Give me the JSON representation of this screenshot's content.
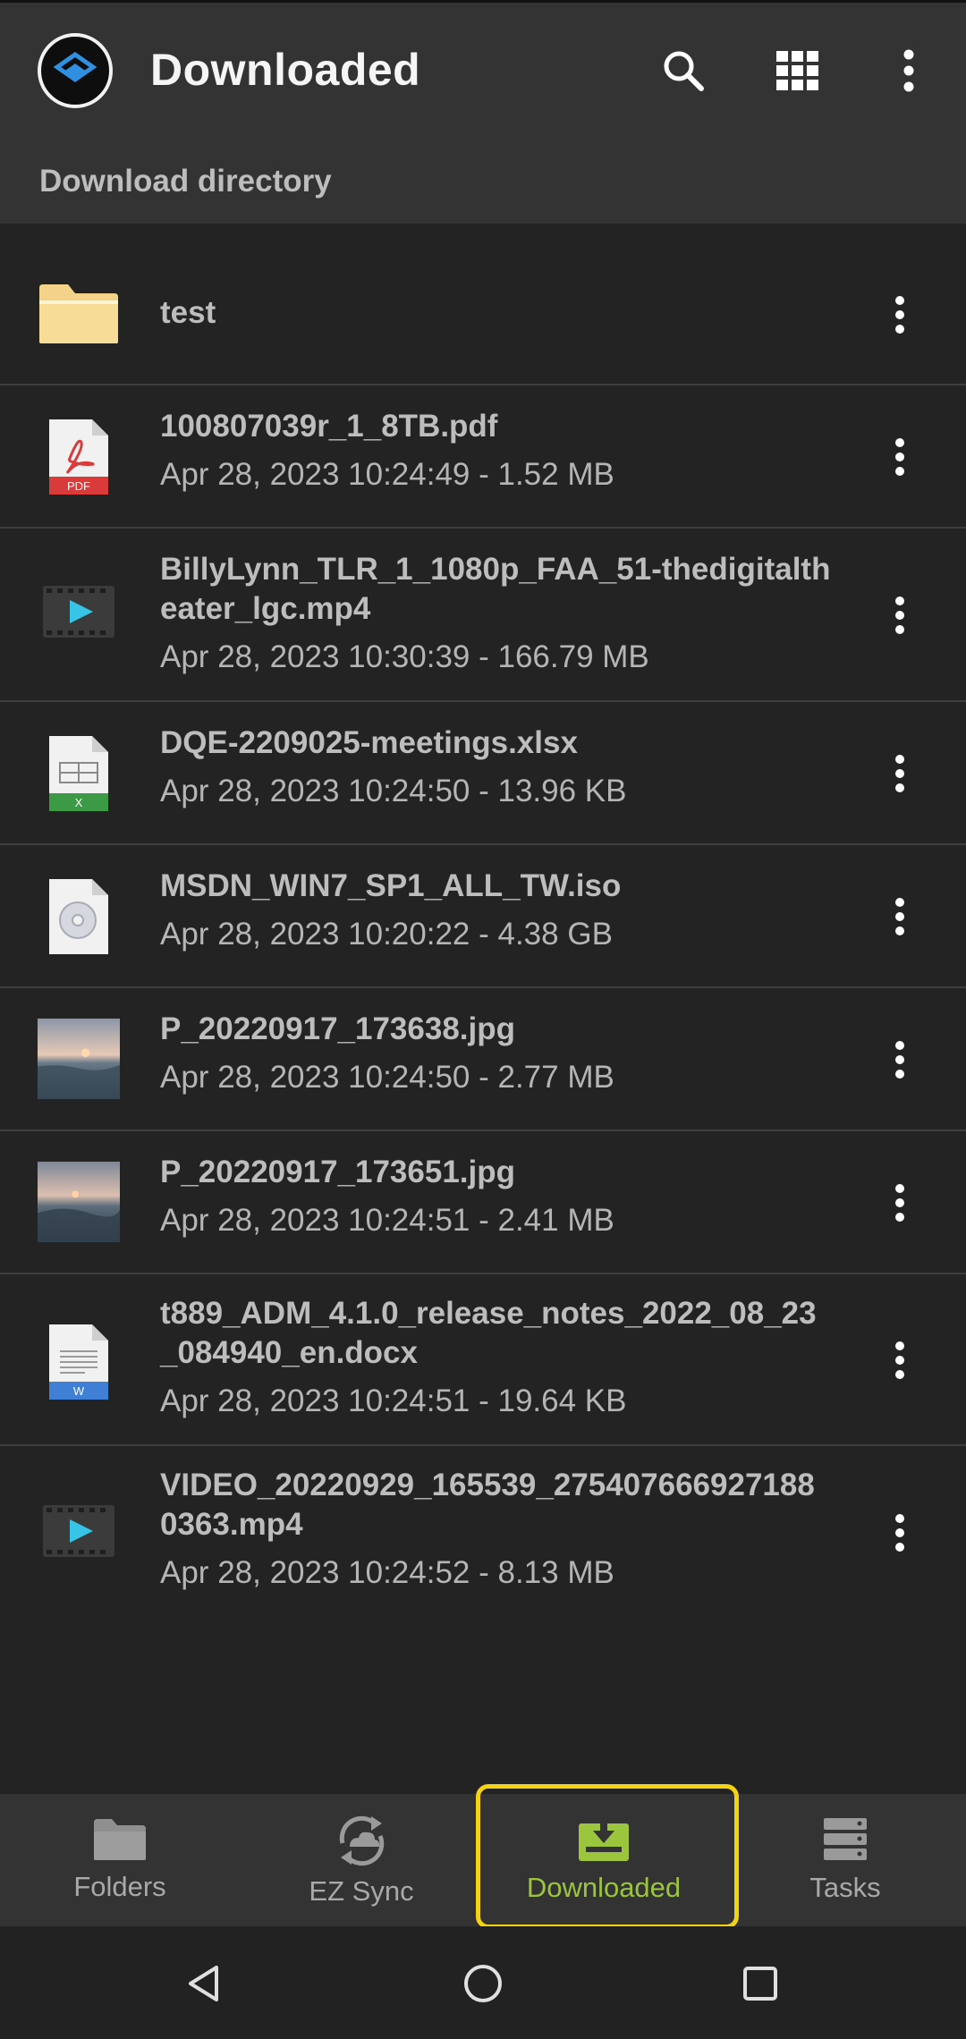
{
  "app": {
    "title": "Downloaded",
    "subheader": "Download directory",
    "logo_icon": "app-logo-icon",
    "actions": [
      "search-icon",
      "grid-view-icon",
      "more-vert-icon"
    ]
  },
  "files": [
    {
      "name": "test",
      "meta": "",
      "type": "folder"
    },
    {
      "name": "100807039r_1_8TB.pdf",
      "meta": "Apr 28, 2023 10:24:49 - 1.52 MB",
      "type": "pdf"
    },
    {
      "name": "BillyLynn_TLR_1_1080p_FAA_51-thedigitaltheater_lgc.mp4",
      "meta": "Apr 28, 2023 10:30:39 - 166.79 MB",
      "type": "video"
    },
    {
      "name": "DQE-2209025-meetings.xlsx",
      "meta": "Apr 28, 2023 10:24:50 - 13.96 KB",
      "type": "xlsx"
    },
    {
      "name": "MSDN_WIN7_SP1_ALL_TW.iso",
      "meta": "Apr 28, 2023 10:20:22 - 4.38 GB",
      "type": "iso"
    },
    {
      "name": "P_20220917_173638.jpg",
      "meta": "Apr 28, 2023 10:24:50 - 2.77 MB",
      "type": "image"
    },
    {
      "name": "P_20220917_173651.jpg",
      "meta": "Apr 28, 2023 10:24:51 - 2.41 MB",
      "type": "image"
    },
    {
      "name": "t889_ADM_4.1.0_release_notes_2022_08_23_084940_en.docx",
      "meta": "Apr 28, 2023 10:24:51 - 19.64 KB",
      "type": "docx"
    },
    {
      "name": "VIDEO_20220929_165539_2754076669271880363.mp4",
      "meta": "Apr 28, 2023 10:24:52 - 8.13 MB",
      "type": "video"
    }
  ],
  "file_badges": {
    "pdf": "PDF",
    "xlsx": "X",
    "docx": "W"
  },
  "bottom_nav": [
    {
      "label": "Folders",
      "icon": "folder-icon"
    },
    {
      "label": "EZ Sync",
      "icon": "ez-sync-icon"
    },
    {
      "label": "Downloaded",
      "icon": "download-tray-icon",
      "active": true
    },
    {
      "label": "Tasks",
      "icon": "tasks-stack-icon"
    }
  ],
  "system_nav": [
    "back-icon",
    "home-icon",
    "recents-icon"
  ],
  "colors": {
    "accent": "#9bc53d",
    "highlight": "#f5d312",
    "pdf_red": "#d93a3a",
    "xlsx_green": "#3c9a47",
    "docx_blue": "#3f7fd6",
    "play_cyan": "#38c4e6"
  }
}
